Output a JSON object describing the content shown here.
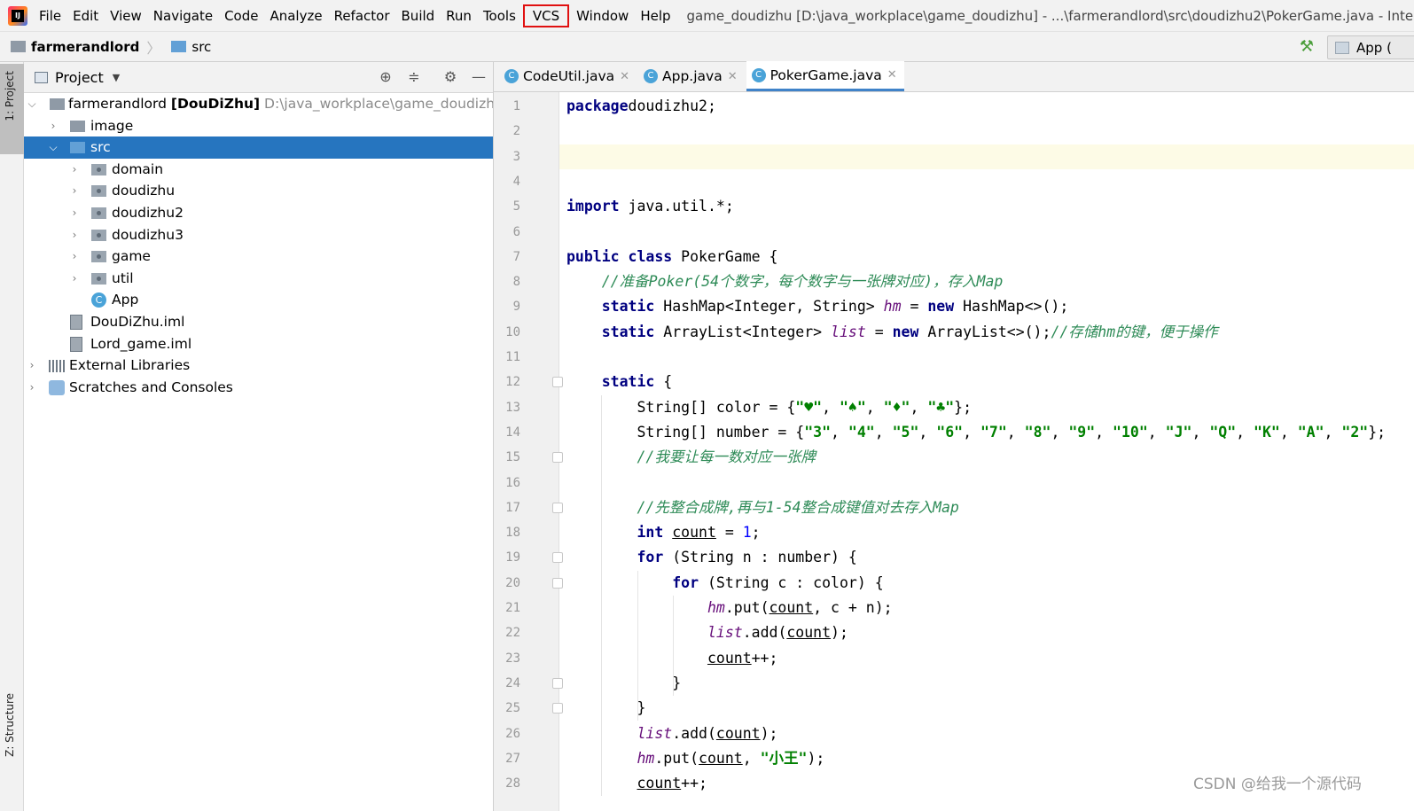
{
  "menu": {
    "items": [
      "File",
      "Edit",
      "View",
      "Navigate",
      "Code",
      "Analyze",
      "Refactor",
      "Build",
      "Run",
      "Tools",
      "VCS",
      "Window",
      "Help"
    ],
    "highlighted": "VCS",
    "window_title": "game_doudizhu [D:\\java_workplace\\game_doudizhu] - ...\\farmerandlord\\src\\doudizhu2\\PokerGame.java - IntelliJ"
  },
  "navbar": {
    "crumbs": [
      "farmerandlord",
      "src"
    ],
    "run_config": "App ("
  },
  "stripe": {
    "project": "1: Project",
    "structure": "Z: Structure"
  },
  "project_panel": {
    "title": "Project",
    "root_name": "farmerandlord",
    "root_module": "[DouDiZhu]",
    "root_path": "D:\\java_workplace\\game_doudizhu\\farr",
    "tree": [
      {
        "label": "image",
        "kind": "folder"
      },
      {
        "label": "src",
        "kind": "src",
        "selected": true
      },
      {
        "label": "domain",
        "kind": "package"
      },
      {
        "label": "doudizhu",
        "kind": "package"
      },
      {
        "label": "doudizhu2",
        "kind": "package"
      },
      {
        "label": "doudizhu3",
        "kind": "package"
      },
      {
        "label": "game",
        "kind": "package"
      },
      {
        "label": "util",
        "kind": "package"
      },
      {
        "label": "App",
        "kind": "class"
      },
      {
        "label": "DouDiZhu.iml",
        "kind": "iml"
      },
      {
        "label": "Lord_game.iml",
        "kind": "iml"
      },
      {
        "label": "External Libraries",
        "kind": "lib"
      },
      {
        "label": "Scratches and Consoles",
        "kind": "scratch"
      }
    ]
  },
  "editor": {
    "tabs": [
      {
        "label": "CodeUtil.java",
        "active": false
      },
      {
        "label": "App.java",
        "active": false
      },
      {
        "label": "PokerGame.java",
        "active": true
      }
    ],
    "caret_line": 3,
    "lines": [
      [
        [
          "kw",
          "package"
        ],
        [
          "",
          "doudizhu2;"
        ]
      ],
      [],
      [],
      [],
      [
        [
          "kw",
          "import"
        ],
        [
          "",
          " java.util.*;"
        ]
      ],
      [],
      [
        [
          "kw",
          "public class"
        ],
        [
          "",
          " PokerGame {"
        ]
      ],
      [
        [
          "",
          "    "
        ],
        [
          "cm",
          "//准备Poker(54个数字，每个数字与一张牌对应)，存入Map"
        ]
      ],
      [
        [
          "",
          "    "
        ],
        [
          "kw",
          "static"
        ],
        [
          "",
          " HashMap<Integer, String> "
        ],
        [
          "fld",
          "hm"
        ],
        [
          "",
          " = "
        ],
        [
          "kw",
          "new"
        ],
        [
          "",
          " HashMap<>();"
        ]
      ],
      [
        [
          "",
          "    "
        ],
        [
          "kw",
          "static"
        ],
        [
          "",
          " ArrayList<Integer> "
        ],
        [
          "fld",
          "list"
        ],
        [
          "",
          " = "
        ],
        [
          "kw",
          "new"
        ],
        [
          "",
          " ArrayList<>();"
        ],
        [
          "cm",
          "//存储hm的键，便于操作"
        ]
      ],
      [],
      [
        [
          "",
          "    "
        ],
        [
          "kw",
          "static"
        ],
        [
          "",
          " {"
        ]
      ],
      [
        [
          "",
          "        String[] color = {"
        ],
        [
          "str",
          "\"♥\""
        ],
        [
          "",
          ", "
        ],
        [
          "str",
          "\"♠\""
        ],
        [
          "",
          ", "
        ],
        [
          "str",
          "\"♦\""
        ],
        [
          "",
          ", "
        ],
        [
          "str",
          "\"♣\""
        ],
        [
          "",
          "};"
        ]
      ],
      [
        [
          "",
          "        String[] number = {"
        ],
        [
          "str",
          "\"3\""
        ],
        [
          "",
          ", "
        ],
        [
          "str",
          "\"4\""
        ],
        [
          "",
          ", "
        ],
        [
          "str",
          "\"5\""
        ],
        [
          "",
          ", "
        ],
        [
          "str",
          "\"6\""
        ],
        [
          "",
          ", "
        ],
        [
          "str",
          "\"7\""
        ],
        [
          "",
          ", "
        ],
        [
          "str",
          "\"8\""
        ],
        [
          "",
          ", "
        ],
        [
          "str",
          "\"9\""
        ],
        [
          "",
          ", "
        ],
        [
          "str",
          "\"10\""
        ],
        [
          "",
          ", "
        ],
        [
          "str",
          "\"J\""
        ],
        [
          "",
          ", "
        ],
        [
          "str",
          "\"Q\""
        ],
        [
          "",
          ", "
        ],
        [
          "str",
          "\"K\""
        ],
        [
          "",
          ", "
        ],
        [
          "str",
          "\"A\""
        ],
        [
          "",
          ", "
        ],
        [
          "str",
          "\"2\""
        ],
        [
          "",
          "};"
        ]
      ],
      [
        [
          "",
          "        "
        ],
        [
          "cm",
          "//我要让每一数对应一张牌"
        ]
      ],
      [],
      [
        [
          "",
          "        "
        ],
        [
          "cm",
          "//先整合成牌,再与1-54整合成键值对去存入Map"
        ]
      ],
      [
        [
          "",
          "        "
        ],
        [
          "kw",
          "int"
        ],
        [
          "",
          " "
        ],
        [
          "ul",
          "count"
        ],
        [
          "",
          " = "
        ],
        [
          "num",
          "1"
        ],
        [
          "",
          ";"
        ]
      ],
      [
        [
          "",
          "        "
        ],
        [
          "kw",
          "for"
        ],
        [
          "",
          " (String n : number) {"
        ]
      ],
      [
        [
          "",
          "            "
        ],
        [
          "kw",
          "for"
        ],
        [
          "",
          " (String c : color) {"
        ]
      ],
      [
        [
          "",
          "                "
        ],
        [
          "fld",
          "hm"
        ],
        [
          "",
          ".put("
        ],
        [
          "ul",
          "count"
        ],
        [
          "",
          ", c + n);"
        ]
      ],
      [
        [
          "",
          "                "
        ],
        [
          "fld",
          "list"
        ],
        [
          "",
          ".add("
        ],
        [
          "ul",
          "count"
        ],
        [
          "",
          ");"
        ]
      ],
      [
        [
          "",
          "                "
        ],
        [
          "ul",
          "count"
        ],
        [
          "",
          "++;"
        ]
      ],
      [
        [
          "",
          "            }"
        ]
      ],
      [
        [
          "",
          "        }"
        ]
      ],
      [
        [
          "",
          "        "
        ],
        [
          "fld",
          "list"
        ],
        [
          "",
          ".add("
        ],
        [
          "ul",
          "count"
        ],
        [
          "",
          ");"
        ]
      ],
      [
        [
          "",
          "        "
        ],
        [
          "fld",
          "hm"
        ],
        [
          "",
          ".put("
        ],
        [
          "ul",
          "count"
        ],
        [
          "",
          ", "
        ],
        [
          "str",
          "\"小王\""
        ],
        [
          "",
          ");"
        ]
      ],
      [
        [
          "",
          "        "
        ],
        [
          "ul",
          "count"
        ],
        [
          "",
          "++;"
        ]
      ]
    ]
  },
  "watermark": "CSDN @给我一个源代码"
}
